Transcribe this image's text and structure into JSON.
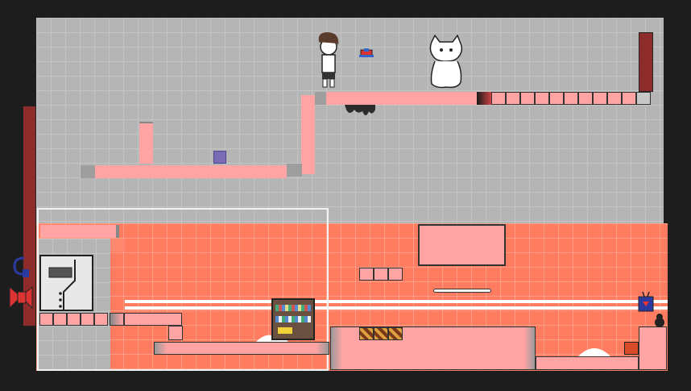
{
  "colors": {
    "background": "#1d1d1d",
    "upper_floor": "#b5b5b5",
    "lower_floor": "#ff7c60",
    "platform": "#ffa4a4",
    "blocker": "#7a6bb5",
    "hazard": "#e0a040",
    "wall_dark_red": "#8e2b2b"
  },
  "entities": {
    "player": "brown-haired-boy-sprite",
    "cat": "white-cat-creature-sprite",
    "bird": "small-bird-sprite",
    "tv": "blue-tv-sprite",
    "shadow": "black-cat-sprite",
    "jar": "red-jar-sprite"
  },
  "icons": {
    "door": "elevator-door-icon",
    "bookshelf": "bookshelf-icon",
    "hook": "hook-icon",
    "bow": "red-bow-icon",
    "goo": "black-goo-icon",
    "crates": "hazard-crate-icon",
    "snow": "snow-pile-icon"
  }
}
